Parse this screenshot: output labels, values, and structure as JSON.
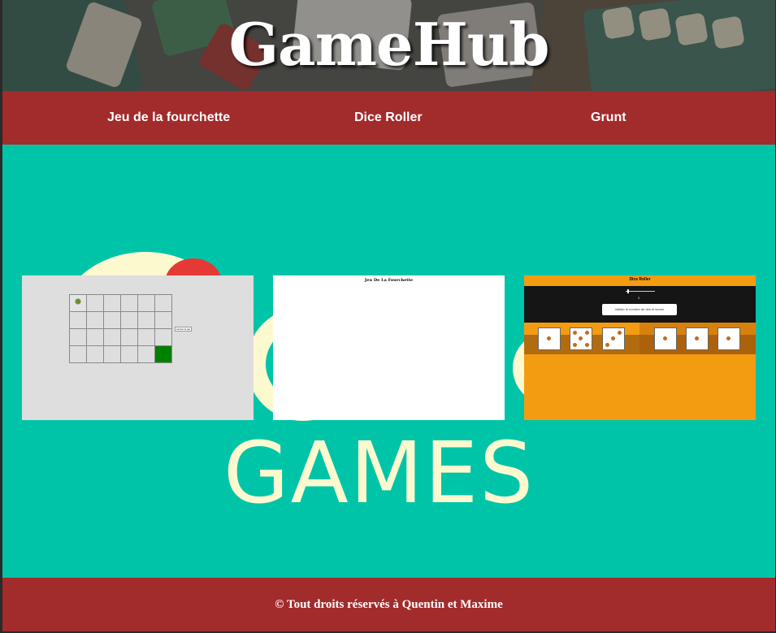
{
  "header": {
    "title": "GameHub"
  },
  "nav": {
    "items": [
      {
        "label": "Jeu de la fourchette"
      },
      {
        "label": "Dice Roller"
      },
      {
        "label": "Grunt"
      }
    ]
  },
  "main": {
    "background_word": "GAMES",
    "cards": [
      {
        "preview": "grid-game",
        "side_button": "Lancer le jeu"
      },
      {
        "preview": "blank-page",
        "title": "Jeu De La Fourchette"
      },
      {
        "preview": "dice-roller",
        "title": "Dice Roller",
        "slider_value": "3",
        "button_label": "Valider le nombre de dés et lancer"
      }
    ]
  },
  "footer": {
    "text": "© Tout droits réservés à Quentin et Maxime"
  },
  "colors": {
    "accent_red": "#a22b2b",
    "teal": "#00c4a8",
    "cream": "#fdf9cf",
    "orange": "#f39c12",
    "green_cell": "#008000"
  }
}
